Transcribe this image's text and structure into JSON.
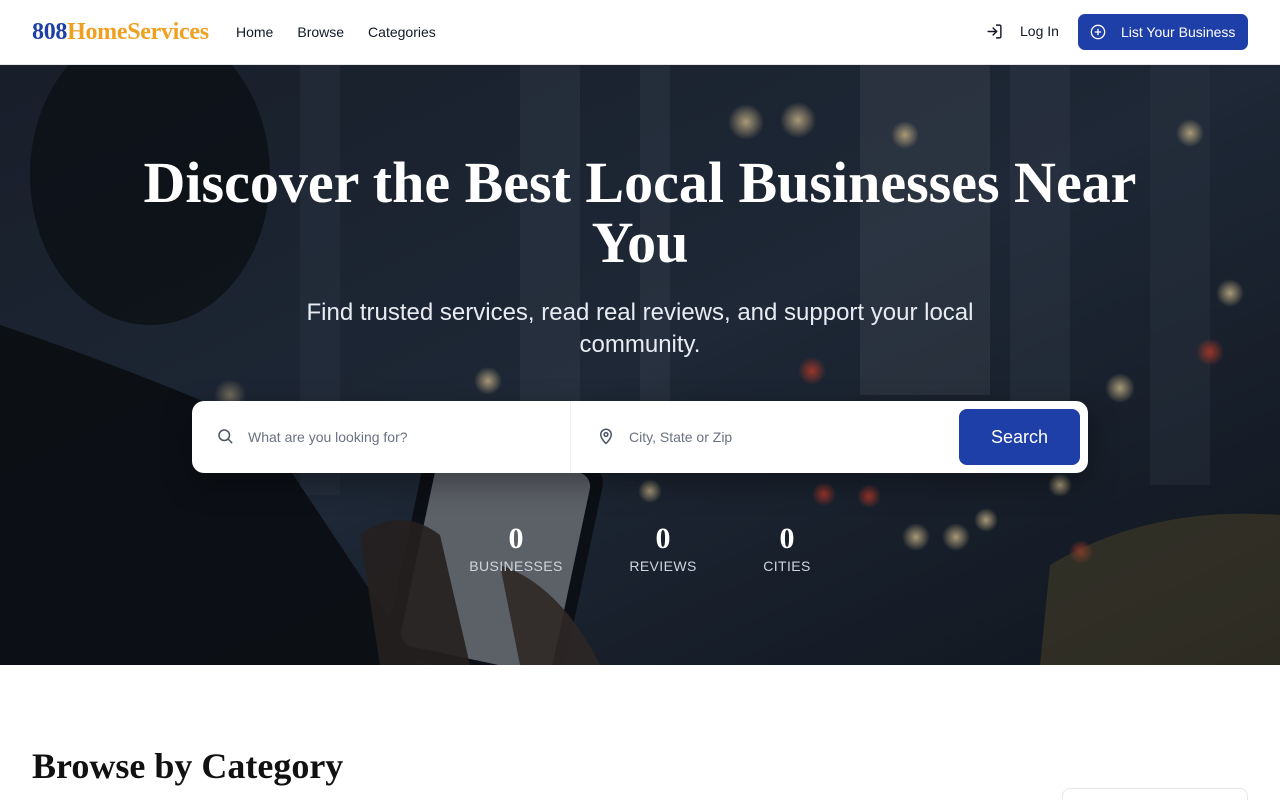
{
  "header": {
    "logo_part1": "808",
    "logo_part2": "HomeServices",
    "nav": [
      "Home",
      "Browse",
      "Categories"
    ],
    "login_label": "Log In",
    "list_business_label": "List Your Business"
  },
  "hero": {
    "title": "Discover the Best Local Businesses Near You",
    "subtitle": "Find trusted services, read real reviews, and support your local community.",
    "search": {
      "what_placeholder": "What are you looking for?",
      "where_placeholder": "City, State or Zip",
      "button_label": "Search"
    },
    "stats": [
      {
        "value": "0",
        "label": "BUSINESSES"
      },
      {
        "value": "0",
        "label": "REVIEWS"
      },
      {
        "value": "0",
        "label": "CITIES"
      }
    ]
  },
  "categories": {
    "title": "Browse by Category"
  },
  "icons": {
    "login": "login-icon",
    "add": "plus-circle-icon",
    "search": "search-icon",
    "location": "map-pin-icon"
  },
  "colors": {
    "brand_primary": "#1e3ea8",
    "brand_accent": "#f0a020",
    "hero_overlay": "#141b26"
  }
}
